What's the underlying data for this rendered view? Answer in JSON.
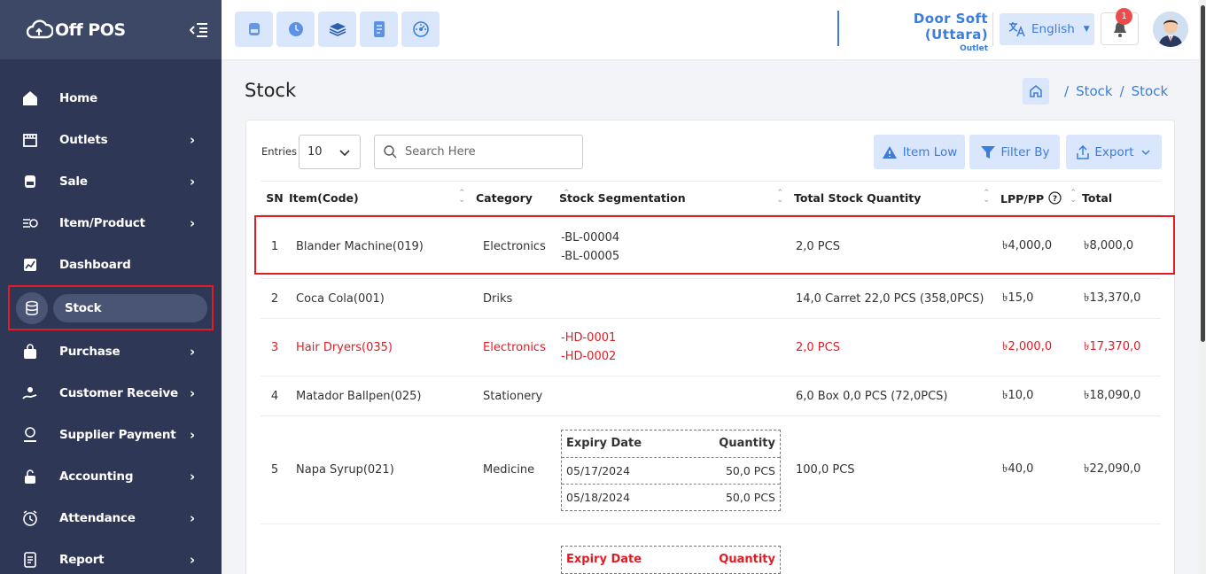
{
  "app": {
    "logo_text": "Off POS"
  },
  "sidebar": {
    "items": [
      {
        "label": "Home",
        "icon": "home-icon",
        "chevron": false
      },
      {
        "label": "Outlets",
        "icon": "store-icon",
        "chevron": true
      },
      {
        "label": "Sale",
        "icon": "sale-icon",
        "chevron": true
      },
      {
        "label": "Item/Product",
        "icon": "product-icon",
        "chevron": true
      },
      {
        "label": "Dashboard",
        "icon": "chart-icon",
        "chevron": false
      },
      {
        "label": "Stock",
        "icon": "database-icon",
        "chevron": false,
        "active": true
      },
      {
        "label": "Purchase",
        "icon": "bag-icon",
        "chevron": true
      },
      {
        "label": "Customer Receive",
        "icon": "receive-icon",
        "chevron": true
      },
      {
        "label": "Supplier Payment",
        "icon": "payment-icon",
        "chevron": true
      },
      {
        "label": "Accounting",
        "icon": "lock-icon",
        "chevron": true
      },
      {
        "label": "Attendance",
        "icon": "clock-icon",
        "chevron": true
      },
      {
        "label": "Report",
        "icon": "report-icon",
        "chevron": true
      }
    ]
  },
  "topbar": {
    "store_name": "Door Soft (Uttara)",
    "store_type": "Outlet",
    "language": "English",
    "notification_count": "1"
  },
  "page": {
    "title": "Stock",
    "breadcrumbs": [
      "Stock",
      "Stock"
    ]
  },
  "toolbar": {
    "entries_label": "Entries",
    "entries_value": "10",
    "search_placeholder": "Search Here",
    "item_low": "Item Low",
    "filter_by": "Filter By",
    "export": "Export"
  },
  "table": {
    "columns": [
      "SN",
      "Item(Code)",
      "Category",
      "Stock Segmentation",
      "Total Stock Quantity",
      "LPP/PP",
      "Total"
    ],
    "rows": [
      {
        "sn": "1",
        "item": "Blander Machine(019)",
        "category": "Electronics",
        "segments": [
          "-BL-00004",
          "-BL-00005"
        ],
        "qty": "2,0 PCS",
        "lpp": "৳4,000,0",
        "total": "৳8,000,0",
        "red": false
      },
      {
        "sn": "2",
        "item": "Coca Cola(001)",
        "category": "Driks",
        "segments": [],
        "qty": "14,0 Carret 22,0 PCS (358,0PCS)",
        "lpp": "৳15,0",
        "total": "৳13,370,0",
        "red": false
      },
      {
        "sn": "3",
        "item": "Hair Dryers(035)",
        "category": "Electronics",
        "segments": [
          "-HD-0001",
          "-HD-0002"
        ],
        "qty": "2,0 PCS",
        "lpp": "৳2,000,0",
        "total": "৳17,370,0",
        "red": true
      },
      {
        "sn": "4",
        "item": "Matador Ballpen(025)",
        "category": "Stationery",
        "segments": [],
        "qty": "6,0 Box 0,0 PCS (72,0PCS)",
        "lpp": "৳10,0",
        "total": "৳18,090,0",
        "red": false
      },
      {
        "sn": "5",
        "item": "Napa Syrup(021)",
        "category": "Medicine",
        "expiry": {
          "head_date": "Expiry Date",
          "head_qty": "Quantity",
          "rows": [
            {
              "date": "05/17/2024",
              "qty": "50,0 PCS"
            },
            {
              "date": "05/18/2024",
              "qty": "50,0 PCS"
            }
          ]
        },
        "qty": "100,0 PCS",
        "lpp": "৳40,0",
        "total": "৳22,090,0",
        "red": false
      },
      {
        "sn": "",
        "item": "",
        "category": "",
        "expiry": {
          "head_date": "Expiry Date",
          "head_qty": "Quantity",
          "rows": []
        },
        "qty": "",
        "lpp": "",
        "total": "",
        "red": true
      }
    ]
  }
}
